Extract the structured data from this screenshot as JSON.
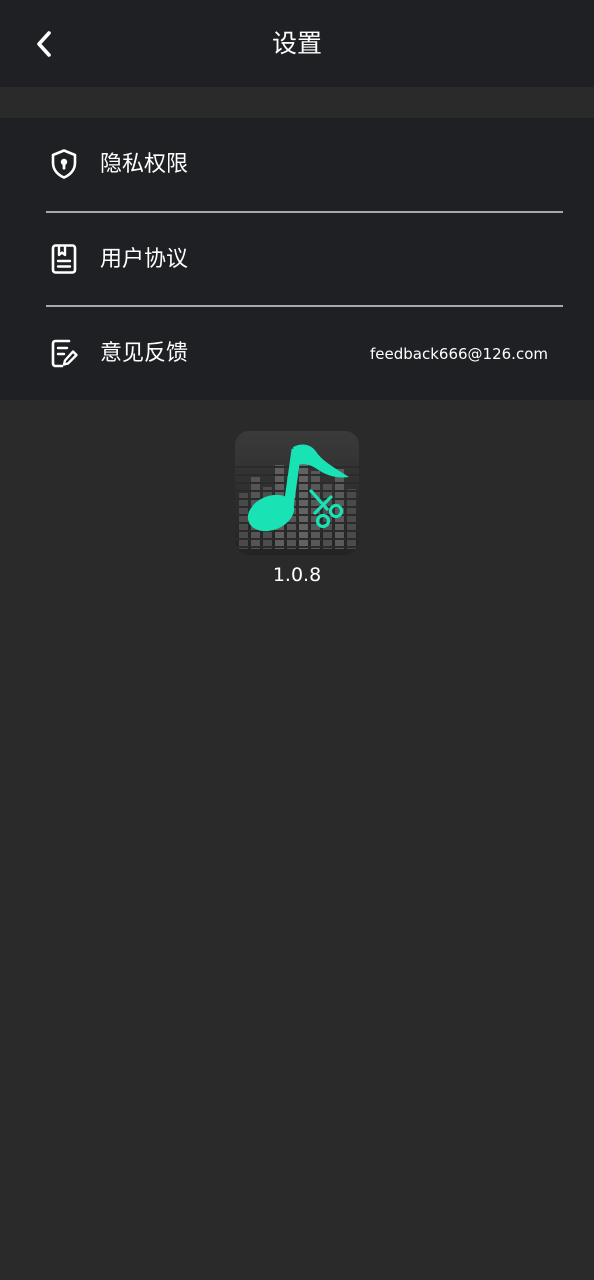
{
  "header": {
    "title": "设置",
    "back_icon": "chevron-left-icon"
  },
  "menu": {
    "items": [
      {
        "label": "隐私权限",
        "icon": "shield-lock-icon",
        "value": ""
      },
      {
        "label": "用户协议",
        "icon": "document-bookmark-icon",
        "value": ""
      },
      {
        "label": "意见反馈",
        "icon": "edit-note-icon",
        "value": "feedback666@126.com"
      }
    ]
  },
  "about": {
    "app_icon": "music-note-scissors-icon",
    "version": "1.0.8"
  },
  "colors": {
    "header_bg": "#1f2024",
    "page_bg": "#2a2a2a",
    "divider": "#a9a9ab",
    "accent": "#19e3b5",
    "text": "#ffffff"
  }
}
